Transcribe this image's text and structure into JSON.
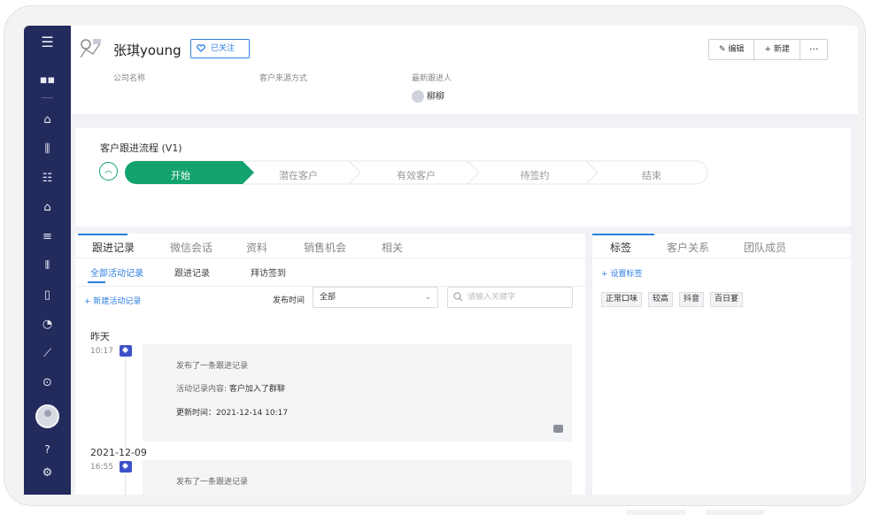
{
  "customer": {
    "name": "张琪young",
    "follow_label": "已关注"
  },
  "header_actions": {
    "edit": "编辑",
    "new": "新建",
    "more": "···"
  },
  "fields": {
    "company_label": "公司名称",
    "source_label": "客户来源方式",
    "latest_follower_label": "最新跟进人",
    "latest_follower": "柳柳"
  },
  "process": {
    "title": "客户跟进流程 (V1)",
    "stages": [
      "开始",
      "潜在客户",
      "有效客户",
      "待签约",
      "结束"
    ],
    "current_stage_index": 0
  },
  "left_tabs": [
    "跟进记录",
    "微信会话",
    "资料",
    "销售机会",
    "相关"
  ],
  "sub_tabs": [
    "全部活动记录",
    "跟进记录",
    "拜访签到"
  ],
  "toolbar": {
    "add_activity": "+ 新建活动记录",
    "publish_time_label": "发布时间",
    "publish_time_value": "全部",
    "search_placeholder": "请输入关键字"
  },
  "timeline": [
    {
      "date": "昨天",
      "time": "10:17",
      "title": "发布了一条跟进记录",
      "content_label": "活动记录内容:",
      "content": "客户加入了群聊",
      "updated": "更新时间：2021-12-14 10:17"
    },
    {
      "date": "2021-12-09",
      "time": "16:55",
      "title": "发布了一条跟进记录"
    }
  ],
  "right_tabs": [
    "标签",
    "客户关系",
    "团队成员"
  ],
  "tags": {
    "set_label": "+ 设置标签",
    "items": [
      "正常口味",
      "较高",
      "抖音",
      "百日宴"
    ]
  },
  "colors": {
    "sidebar": "#232a5c",
    "accent": "#2d7fe0",
    "stage_active": "#12a36f"
  }
}
